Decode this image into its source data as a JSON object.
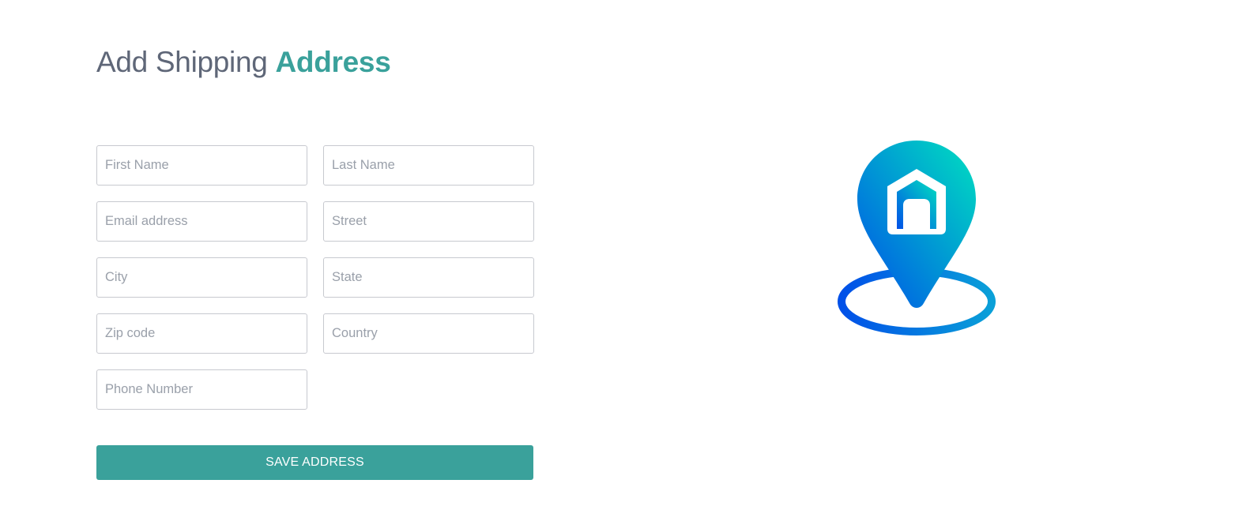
{
  "header": {
    "title_part1": "Add Shipping ",
    "title_part2": "Address"
  },
  "form": {
    "fields": {
      "first_name": {
        "placeholder": "First Name",
        "value": ""
      },
      "last_name": {
        "placeholder": "Last Name",
        "value": ""
      },
      "email": {
        "placeholder": "Email address",
        "value": ""
      },
      "street": {
        "placeholder": "Street",
        "value": ""
      },
      "city": {
        "placeholder": "City",
        "value": ""
      },
      "state": {
        "placeholder": "State",
        "value": ""
      },
      "zip": {
        "placeholder": "Zip code",
        "value": ""
      },
      "country": {
        "placeholder": "Country",
        "value": ""
      },
      "phone": {
        "placeholder": "Phone Number",
        "value": ""
      }
    },
    "save_label": "SAVE ADDRESS"
  },
  "illustration": {
    "icon": "location-pin-home-icon",
    "gradient_start": "#00e0c0",
    "gradient_end": "#0050e8"
  },
  "colors": {
    "accent": "#3aa19b",
    "title_gray": "#5f6778",
    "border": "#c7c9cf",
    "placeholder": "#9aa0aa"
  }
}
